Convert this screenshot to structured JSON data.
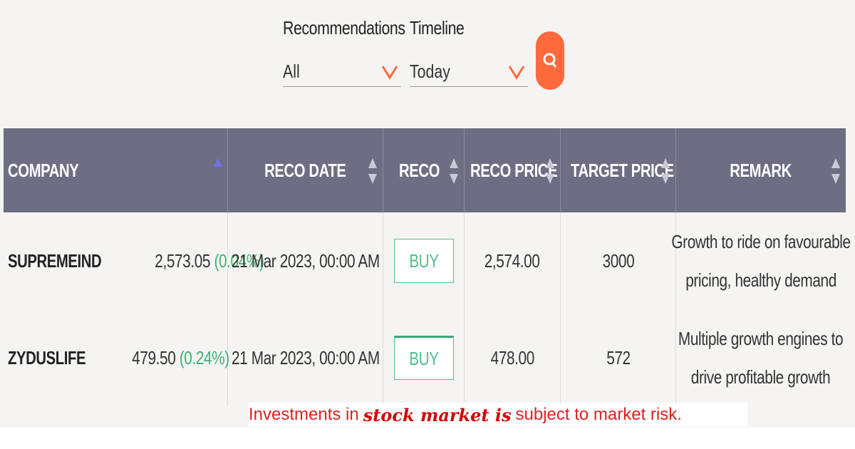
{
  "filters": {
    "recommendations": {
      "label": "Recommendations",
      "value": "All"
    },
    "timeline": {
      "label": "Timeline",
      "value": "Today"
    },
    "search_icon": "search-icon"
  },
  "table": {
    "headers": [
      "COMPANY",
      "RECO DATE",
      "RECO",
      "RECO PRICE",
      "TARGET PRICE",
      "REMARK"
    ],
    "rows": [
      {
        "company": "SUPREMEIND",
        "price": "2,573.05",
        "change": "(0.04%)",
        "reco_date": "21 Mar 2023, 00:00 AM",
        "reco": "BUY",
        "reco_price": "2,574.00",
        "target_price": "3000",
        "remark_line1": "Growth to ride on favourable",
        "remark_line2": "pricing, healthy demand"
      },
      {
        "company": "ZYDUSLIFE",
        "price": "479.50",
        "change": "(0.24%)",
        "reco_date": "21 Mar 2023, 00:00 AM",
        "reco": "BUY",
        "reco_price": "478.00",
        "target_price": "572",
        "remark_line1": "Multiple growth engines to",
        "remark_line2": "drive profitable growth"
      }
    ]
  },
  "disclaimer": {
    "prefix": "Investments in",
    "emphasis": "stock market is",
    "suffix": "subject to market risk."
  },
  "colors": {
    "header_bg": "#6d6e83",
    "accent": "#ff6a3d",
    "buy_green": "#4fbf8b",
    "disclaimer_red": "#e02020"
  }
}
